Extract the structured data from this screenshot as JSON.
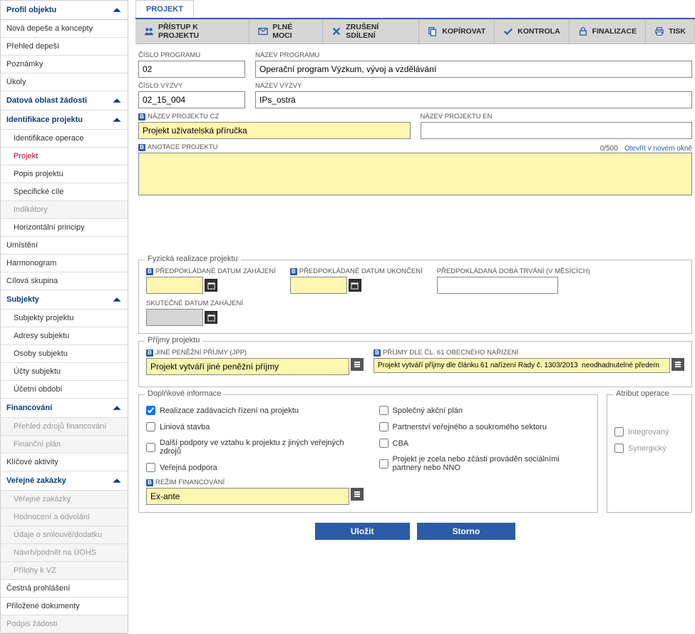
{
  "sidebar": {
    "profil_header": "Profil objektu",
    "items1": [
      "Nová depeše a koncepty",
      "Přehled depeší",
      "Poznámky",
      "Úkoly"
    ],
    "datova_header": "Datová oblast žádosti",
    "ident_header": "Identifikace projektu",
    "ident_items": [
      "Identifikace operace",
      "Projekt",
      "Popis projektu",
      "Specifické cíle",
      "Indikátory",
      "Horizontální principy"
    ],
    "after_ident": [
      "Umístění",
      "Harmonogram",
      "Cílová skupina"
    ],
    "subj_header": "Subjekty",
    "subj_items": [
      "Subjekty projektu",
      "Adresy subjektu",
      "Osoby subjektu",
      "Účty subjektu",
      "Účetní období"
    ],
    "fin_header": "Financování",
    "fin_items": [
      "Přehled zdrojů financování",
      "Finanční plán"
    ],
    "after_fin": [
      "Klíčové aktivity"
    ],
    "zak_header": "Veřejné zakázky",
    "zak_items": [
      "Veřejné zakázky",
      "Hodnocení a odvolání",
      "Údaje o smlouvě/dodatku",
      "Návrh/podnět na ÚOHS",
      "Přílohy k VZ"
    ],
    "bottom": [
      "Čestná prohlášení",
      "Přiložené dokumenty",
      "Podpis žádosti"
    ]
  },
  "tab": "PROJEKT",
  "toolbar": {
    "pristup": "PŘÍSTUP K PROJEKTU",
    "plne": "PLNÉ MOCI",
    "zruseni": "ZRUŠENÍ SDÍLENÍ",
    "kopir": "KOPÍROVAT",
    "kontrola": "KONTROLA",
    "final": "FINALIZACE",
    "tisk": "TISK"
  },
  "labels": {
    "cislo_prog": "ČÍSLO PROGRAMU",
    "nazev_prog": "NÁZEV PROGRAMU",
    "cislo_vyzvy": "ČÍSLO VÝZVY",
    "nazev_vyzvy": "NÁZEV VÝZVY",
    "nazev_cz": "NÁZEV PROJEKTU CZ",
    "nazev_en": "NÁZEV PROJEKTU EN",
    "anotace": "ANOTACE PROJEKTU",
    "open_new": "Otevřít v novém okně",
    "count": "0/500",
    "fyz_legend": "Fyzická realizace projektu",
    "pred_zah": "PŘEDPOKLÁDANÉ DATUM ZAHÁJENÍ",
    "pred_uk": "PŘEDPOKLÁDANÉ DATUM UKONČENÍ",
    "doba": "PŘEDPOKLÁDANÁ DOBA TRVÁNÍ (V MĚSÍCÍCH)",
    "skut_zah": "SKUTEČNÉ DATUM ZAHÁJENÍ",
    "prijmy_legend": "Příjmy projektu",
    "jpp": "JINÉ PENĚŽNÍ PŘÍJMY (JPP)",
    "cl61": "PŘÍJMY DLE ČL. 61 OBECNÉHO NAŘÍZENÍ",
    "dopl_legend": "Doplňkové informace",
    "atr_legend": "Atribut operace",
    "chk1": "Realizace zadávacích řízení na projektu",
    "chk2": "Liniová stavba",
    "chk3": "Další podpory ve vztahu k projektu z jiných veřejných zdrojů",
    "chk4": "Veřejná podpora",
    "chk5": "Společný akční plán",
    "chk6": "Partnerství veřejného a soukromého sektoru",
    "chk7": "CBA",
    "chk8": "Projekt je zcela nebo zčásti prováděn sociálními partnery nebo NNO",
    "rezim": "REŽIM FINANCOVÁNÍ",
    "atr1": "Integrovaný",
    "atr2": "Synergický"
  },
  "values": {
    "cislo_prog": "02",
    "nazev_prog": "Operační program Výzkum, vývoj a vzdělávání",
    "cislo_vyzvy": "02_15_004",
    "nazev_vyzvy": "IPs_ostrá",
    "nazev_cz": "Projekt uživatelská příručka",
    "nazev_en": "",
    "jpp": "Projekt vytváří jiné peněžní příjmy",
    "cl61": "Projekt vytváří příjmy dle článku 61 nařízení Rady č. 1303/2013  neodhadnutelné předem",
    "rezim": "Ex-ante"
  },
  "buttons": {
    "save": "Uložit",
    "cancel": "Storno"
  }
}
